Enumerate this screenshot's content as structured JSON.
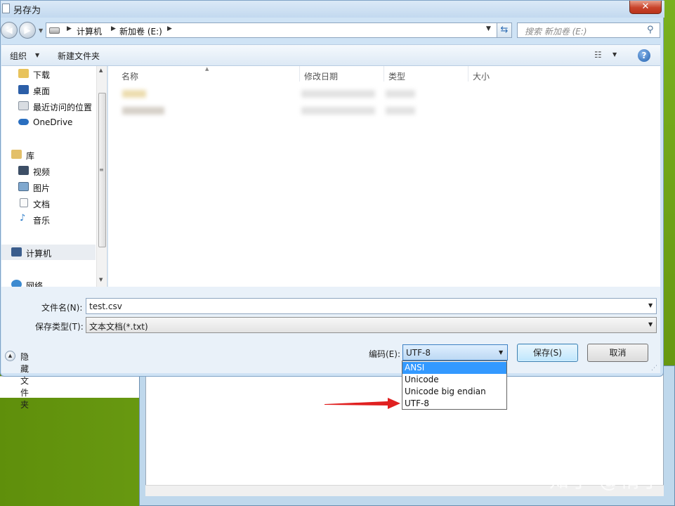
{
  "dialog": {
    "title": "另存为",
    "close_label": "✕"
  },
  "address": {
    "crumbs": [
      "计算机",
      "新加卷 (E:)"
    ],
    "search_placeholder": "搜索 新加卷 (E:)"
  },
  "toolbar": {
    "organize_label": "组织",
    "new_folder_label": "新建文件夹",
    "help_label": "?"
  },
  "nav": {
    "items": [
      {
        "label": "下载",
        "icon": "download-folder-icon"
      },
      {
        "label": "桌面",
        "icon": "desktop-icon"
      },
      {
        "label": "最近访问的位置",
        "icon": "recent-places-icon"
      },
      {
        "label": "OneDrive",
        "icon": "onedrive-cloud-icon"
      },
      {
        "label": "库",
        "icon": "library-icon"
      },
      {
        "label": "视频",
        "icon": "video-icon"
      },
      {
        "label": "图片",
        "icon": "pictures-icon"
      },
      {
        "label": "文档",
        "icon": "documents-icon"
      },
      {
        "label": "音乐",
        "icon": "music-icon"
      },
      {
        "label": "计算机",
        "icon": "computer-icon"
      },
      {
        "label": "网络",
        "icon": "network-icon"
      }
    ]
  },
  "filelist": {
    "columns": [
      "名称",
      "修改日期",
      "类型",
      "大小"
    ]
  },
  "form": {
    "filename_label": "文件名(N):",
    "filename_value": "test.csv",
    "filetype_label": "保存类型(T):",
    "filetype_value": "文本文档(*.txt)",
    "hide_folders_label": "隐藏文件夹",
    "encoding_label": "编码(E):",
    "encoding_value": "UTF-8",
    "save_label": "保存(S)",
    "cancel_label": "取消"
  },
  "encoding_options": [
    "ANSI",
    "Unicode",
    "Unicode big endian",
    "UTF-8"
  ],
  "encoding_highlighted": "ANSI",
  "watermark": "知乎 @惰了",
  "colors": {
    "accent_red": "#e02020",
    "selection_blue": "#3399ff",
    "desktop_green": "#6a9c12"
  }
}
